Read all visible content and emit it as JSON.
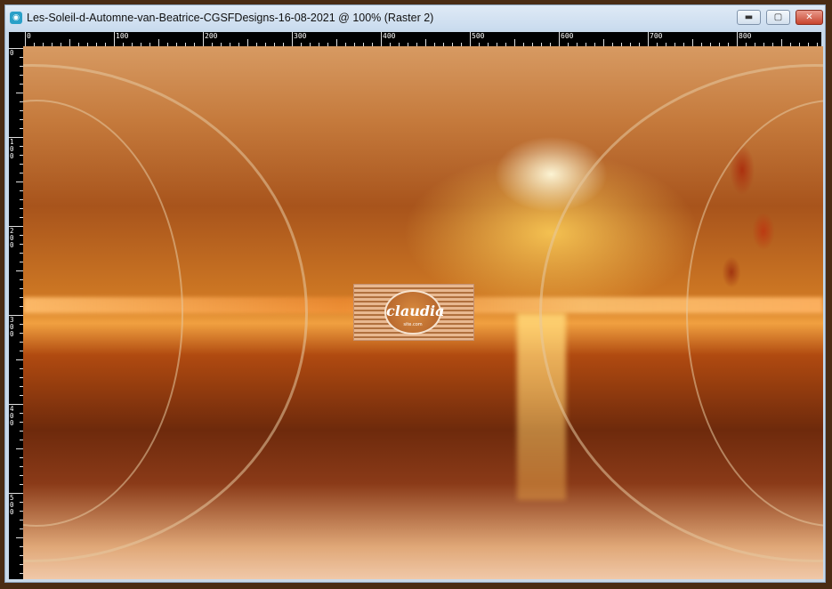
{
  "window": {
    "title": "Les-Soleil-d-Automne-van-Beatrice-CGSFDesigns-16-08-2021 @ 100% (Raster 2)",
    "icon": "paintshop-icon",
    "buttons": {
      "minimize": "▬",
      "maximize": "▢",
      "close": "✕"
    }
  },
  "ruler_top": {
    "labels": [
      "0",
      "100",
      "200",
      "300",
      "400",
      "500",
      "600",
      "700",
      "800"
    ]
  },
  "ruler_left": {
    "labels": [
      "0",
      "100",
      "200",
      "300",
      "400",
      "500"
    ]
  },
  "canvas": {
    "watermark_text": "claudia",
    "watermark_sub": "site.com"
  },
  "colors": {
    "accent": "#2aa0c8",
    "close": "#c8452f",
    "frame": "#4a2c14"
  }
}
